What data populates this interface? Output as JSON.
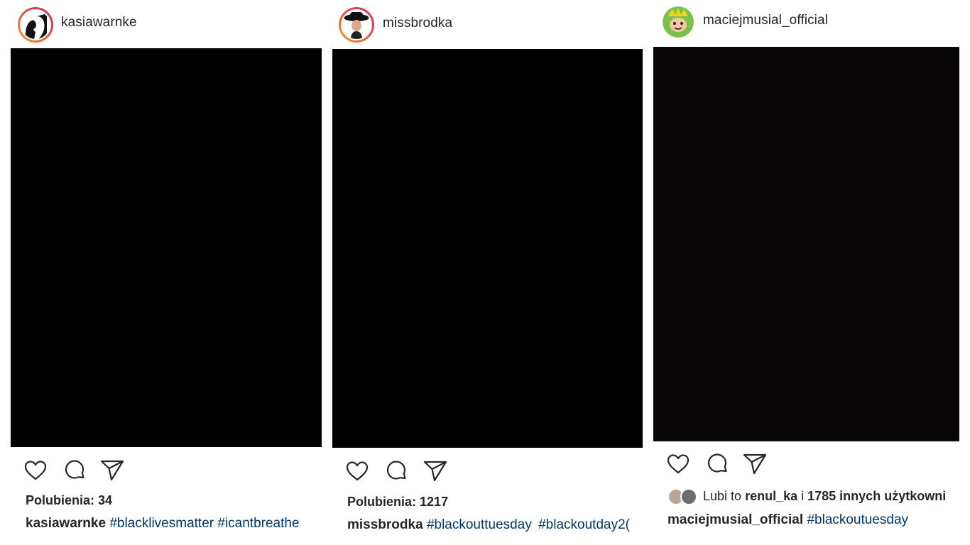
{
  "posts": [
    {
      "username": "kasiawarnke",
      "likes_prefix": "Polubienia:",
      "likes_count": "34",
      "caption_user": "kasiawarnke",
      "hashtags": [
        "#blacklivesmatter",
        "#icantbreathe"
      ]
    },
    {
      "username": "missbrodka",
      "likes_prefix": "Polubienia:",
      "likes_count": "1217",
      "caption_user": "missbrodka",
      "hashtags": [
        "#blackouttuesday",
        "#blackoutday2("
      ]
    },
    {
      "username": "maciejmusial_official",
      "liked_by_prefix": "Lubi to",
      "liked_by_user": "renul_ka",
      "liked_by_joiner": "i",
      "liked_by_others": "1785 innych użytkowni",
      "caption_user": "maciejmusial_official",
      "hashtags": [
        "#blackoutuesday"
      ]
    }
  ],
  "icons": {
    "like": "heart-icon",
    "comment": "comment-icon",
    "share": "paper-plane-icon"
  },
  "colors": {
    "text": "#262626",
    "hashtag": "#00376b",
    "photo": "#000000",
    "story_ring_start": "#f6a433",
    "story_ring_end": "#c2316f"
  }
}
